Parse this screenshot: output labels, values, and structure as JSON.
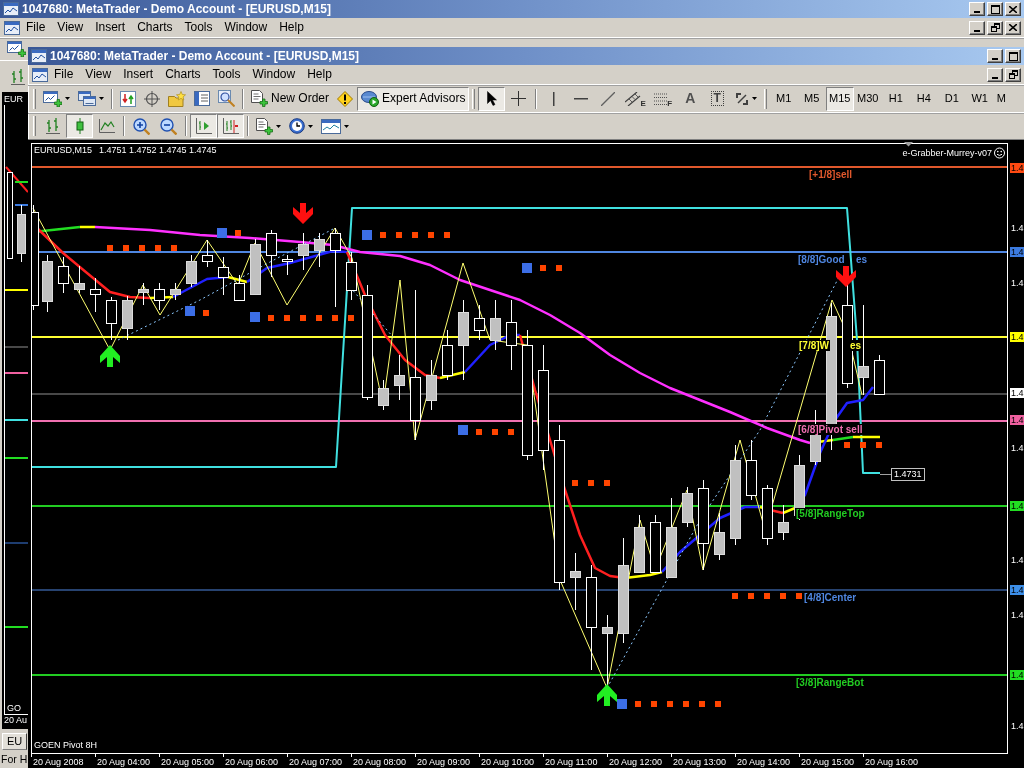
{
  "background_window": {
    "title": "1047680: MetaTrader - Demo Account - [EURUSD,M15]",
    "menu": [
      "File",
      "View",
      "Insert",
      "Charts",
      "Tools",
      "Window",
      "Help"
    ],
    "chart": {
      "symbol": "EUR",
      "indicator": "GO",
      "time_label": "20 Au"
    },
    "tabs": [
      {
        "label": "EU",
        "selected": true
      }
    ],
    "status_bar": "For H"
  },
  "window": {
    "title": "1047680: MetaTrader - Demo Account - [EURUSD,M15]",
    "menu": [
      "File",
      "View",
      "Insert",
      "Charts",
      "Tools",
      "Window",
      "Help"
    ],
    "toolbar": {
      "new_order": "New Order",
      "expert_advisors": {
        "label": "Expert Advisors",
        "pressed": true
      },
      "drawing_tools": [
        {
          "kind": "icon",
          "pressed": true
        },
        {
          "kind": "icon",
          "pressed": false
        },
        {
          "kind": "icon",
          "pressed": false
        },
        {
          "kind": "icon",
          "pressed": false
        },
        {
          "kind": "icon",
          "pressed": false
        },
        {
          "kind": "icon",
          "label": "E",
          "pressed": false
        },
        {
          "kind": "icon",
          "label": "F",
          "pressed": false
        },
        {
          "kind": "letter",
          "label": "A",
          "pressed": false
        },
        {
          "kind": "boxed-letter",
          "label": "T",
          "pressed": false
        },
        {
          "kind": "icon",
          "pressed": false
        }
      ],
      "timeframes": [
        {
          "label": "M1",
          "selected": false
        },
        {
          "label": "M5",
          "selected": false
        },
        {
          "label": "M15",
          "selected": true
        },
        {
          "label": "M30",
          "selected": false
        },
        {
          "label": "H1",
          "selected": false
        },
        {
          "label": "H4",
          "selected": false
        },
        {
          "label": "D1",
          "selected": false
        },
        {
          "label": "W1",
          "selected": false
        },
        {
          "label": "M",
          "selected": false
        }
      ]
    },
    "chart_toolbar": {
      "chart_types": [
        {
          "selected": false
        },
        {
          "selected": true
        },
        {
          "selected": false
        }
      ],
      "auto_scroll": {
        "pressed": true
      },
      "chart_shift": {
        "pressed": true
      }
    },
    "chart": {
      "symbol": "EURUSD,M15",
      "quotes": "1.4751 1.4752 1.4745 1.4745",
      "indicator": "e-Grabber-Murrey-v07",
      "level_labels": [
        {
          "text": "[+1/8]sell",
          "color": "#e0582c"
        },
        {
          "text": "[8/8]Good",
          "color": "#4f86e0"
        },
        {
          "text": "es",
          "color": "#4f86e0"
        },
        {
          "text": "[7/8]W",
          "color": "#ffff33"
        },
        {
          "text": "es",
          "color": "#ffff33"
        },
        {
          "text": "[6/8]Pivot sell",
          "color": "#f070b0"
        },
        {
          "text": "[5/8]RangeTop",
          "color": "#22cc22"
        },
        {
          "text": "[4/8]Center",
          "color": "#4f86e0"
        },
        {
          "text": "[3/8]RangeBot",
          "color": "#22cc22"
        }
      ],
      "price_labels": [
        {
          "text": "1.4",
          "kind": "tag",
          "color": "#ff4a12"
        },
        {
          "text": "1.4",
          "kind": "plain"
        },
        {
          "text": "1.4",
          "kind": "tag",
          "color": "#3c7be0"
        },
        {
          "text": "1.4",
          "kind": "plain"
        },
        {
          "text": "1.4",
          "kind": "tag",
          "color": "#ffff00"
        },
        {
          "text": "1.4",
          "kind": "tag",
          "color": "#ffffff"
        },
        {
          "text": "1.4",
          "kind": "tag",
          "color": "#f060a0"
        },
        {
          "text": "1.4",
          "kind": "plain"
        },
        {
          "text": "1.4",
          "kind": "tag",
          "color": "#22dd22"
        },
        {
          "text": "1.4",
          "kind": "plain"
        },
        {
          "text": "1.4",
          "kind": "tag",
          "color": "#3c8ee8"
        },
        {
          "text": "1.4",
          "kind": "plain"
        },
        {
          "text": "1.4",
          "kind": "tag",
          "color": "#22dd22"
        },
        {
          "text": "1.4",
          "kind": "plain"
        }
      ],
      "last_price": "1.4731",
      "pivot_label": "GOEN Pivot 8H",
      "time_labels": [
        "20 Aug 2008",
        "20 Aug 04:00",
        "20 Aug 05:00",
        "20 Aug 06:00",
        "20 Aug 07:00",
        "20 Aug 08:00",
        "20 Aug 09:00",
        "20 Aug 10:00",
        "20 Aug 11:00",
        "20 Aug 12:00",
        "20 Aug 13:00",
        "20 Aug 14:00",
        "20 Aug 15:00",
        "20 Aug 16:00"
      ]
    }
  }
}
